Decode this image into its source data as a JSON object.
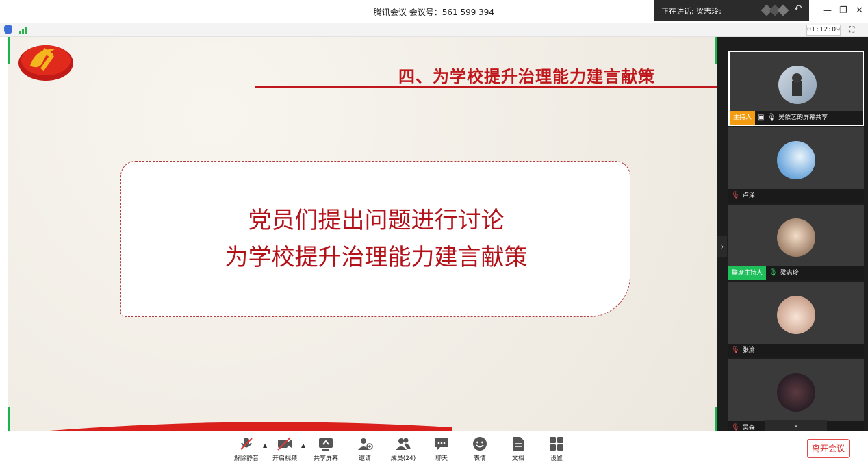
{
  "window": {
    "title": "腾讯会议 会议号：561 599 394",
    "speaking_label": "正在讲话: 梁志玲;",
    "timer": "01:12:09"
  },
  "slide": {
    "heading": "四、为学校提升治理能力建言献策",
    "line1": "党员们提出问题进行讨论",
    "line2": "为学校提升治理能力建言献策"
  },
  "participants": [
    {
      "name": "吴依艺的屏幕共享",
      "tag": "主持人",
      "tag_color": "#f39c12",
      "mic": "on",
      "screen_share": true
    },
    {
      "name": "卢泽",
      "tag": "",
      "mic": "muted"
    },
    {
      "name": "梁志玲",
      "tag": "联席主持人",
      "tag_color": "#1fbf5c",
      "mic": "speaking"
    },
    {
      "name": "张渝",
      "tag": "",
      "mic": "muted"
    },
    {
      "name": "吴森",
      "tag": "",
      "mic": "muted"
    }
  ],
  "toolbar": {
    "unmute": "解除静音",
    "start_video": "开启视频",
    "share_screen": "共享屏幕",
    "invite": "邀请",
    "members": "成员(24)",
    "chat": "聊天",
    "reactions": "表情",
    "docs": "文档",
    "settings": "设置",
    "leave": "离开会议"
  },
  "colors": {
    "accent_red": "#c0171c",
    "host_tag": "#f39c12",
    "cohost_tag": "#1fbf5c",
    "leave_red": "#d93030"
  }
}
